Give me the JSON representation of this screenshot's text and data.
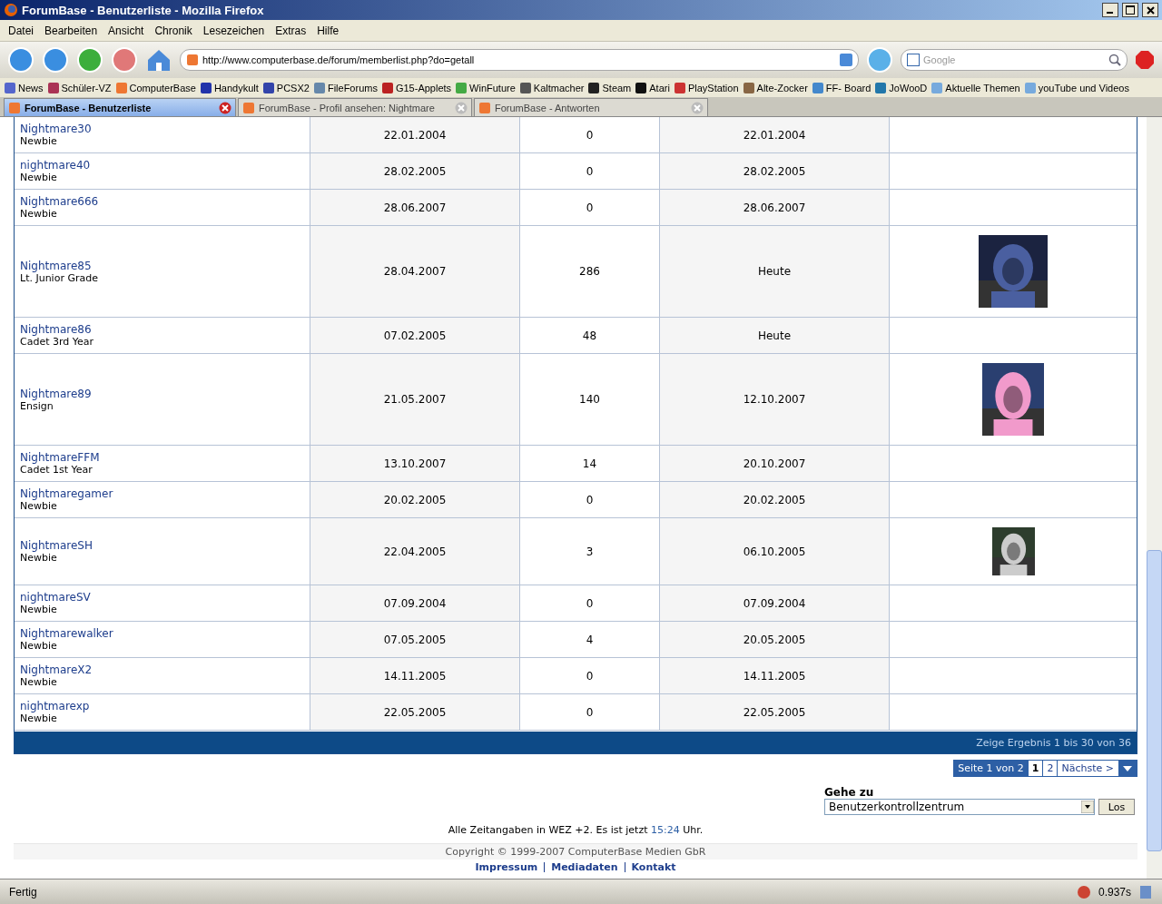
{
  "window": {
    "title": "ForumBase - Benutzerliste - Mozilla Firefox"
  },
  "menu": [
    "Datei",
    "Bearbeiten",
    "Ansicht",
    "Chronik",
    "Lesezeichen",
    "Extras",
    "Hilfe"
  ],
  "address": {
    "value": "http://www.computerbase.de/forum/memberlist.php?do=getall"
  },
  "search": {
    "placeholder": "Google"
  },
  "bookmarks": [
    "News",
    "Schüler-VZ",
    "ComputerBase",
    "Handykult",
    "PCSX2",
    "FileForums",
    "G15-Applets",
    "WinFuture",
    "Kaltmacher",
    "Steam",
    "Atari",
    "PlayStation",
    "Alte-Zocker",
    "FF- Board",
    "JoWooD",
    "Aktuelle Themen",
    "youTube und Videos"
  ],
  "tabs": [
    {
      "label": "ForumBase - Benutzerliste",
      "selected": true
    },
    {
      "label": "ForumBase - Profil ansehen: Nightmare",
      "selected": false
    },
    {
      "label": "ForumBase - Antworten",
      "selected": false
    }
  ],
  "members": [
    {
      "name": "Nightmare30",
      "rank": "Newbie",
      "joined": "22.01.2004",
      "posts": "0",
      "last": "22.01.2004"
    },
    {
      "name": "nightmare40",
      "rank": "Newbie",
      "joined": "28.02.2005",
      "posts": "0",
      "last": "28.02.2005"
    },
    {
      "name": "Nightmare666",
      "rank": "Newbie",
      "joined": "28.06.2007",
      "posts": "0",
      "last": "28.06.2007"
    },
    {
      "name": "Nightmare85",
      "rank": "Lt. Junior Grade",
      "joined": "28.04.2007",
      "posts": "286",
      "last": "Heute"
    },
    {
      "name": "Nightmare86",
      "rank": "Cadet 3rd Year",
      "joined": "07.02.2005",
      "posts": "48",
      "last": "Heute"
    },
    {
      "name": "Nightmare89",
      "rank": "Ensign",
      "joined": "21.05.2007",
      "posts": "140",
      "last": "12.10.2007"
    },
    {
      "name": "NightmareFFM",
      "rank": "Cadet 1st Year",
      "joined": "13.10.2007",
      "posts": "14",
      "last": "20.10.2007"
    },
    {
      "name": "Nightmaregamer",
      "rank": "Newbie",
      "joined": "20.02.2005",
      "posts": "0",
      "last": "20.02.2005"
    },
    {
      "name": "NightmareSH",
      "rank": "Newbie",
      "joined": "22.04.2005",
      "posts": "3",
      "last": "06.10.2005"
    },
    {
      "name": "nightmareSV",
      "rank": "Newbie",
      "joined": "07.09.2004",
      "posts": "0",
      "last": "07.09.2004"
    },
    {
      "name": "Nightmarewalker",
      "rank": "Newbie",
      "joined": "07.05.2005",
      "posts": "4",
      "last": "20.05.2005"
    },
    {
      "name": "NightmareX2",
      "rank": "Newbie",
      "joined": "14.11.2005",
      "posts": "0",
      "last": "14.11.2005"
    },
    {
      "name": "nightmarexp",
      "rank": "Newbie",
      "joined": "22.05.2005",
      "posts": "0",
      "last": "22.05.2005"
    }
  ],
  "results": "Zeige Ergebnis 1 bis 30 von 36",
  "pagination": {
    "label": "Seite 1 von 2",
    "pages": [
      {
        "label": "1",
        "selected": true
      },
      {
        "label": "2",
        "selected": false
      }
    ],
    "next": "Nächste >"
  },
  "jump": {
    "label": "Gehe zu",
    "value": "Benutzerkontrollzentrum",
    "button": "Los"
  },
  "timezone": {
    "text": "Alle Zeitangaben in WEZ +2. Es ist jetzt",
    "time": "15:24",
    "suffix": "Uhr."
  },
  "copyright": "Copyright © 1999-2007 ComputerBase Medien GbR",
  "footer_links": [
    "Impressum",
    "Mediadaten",
    "Kontakt"
  ],
  "status_bar": {
    "text": "Fertig",
    "timing": "0.937s"
  }
}
